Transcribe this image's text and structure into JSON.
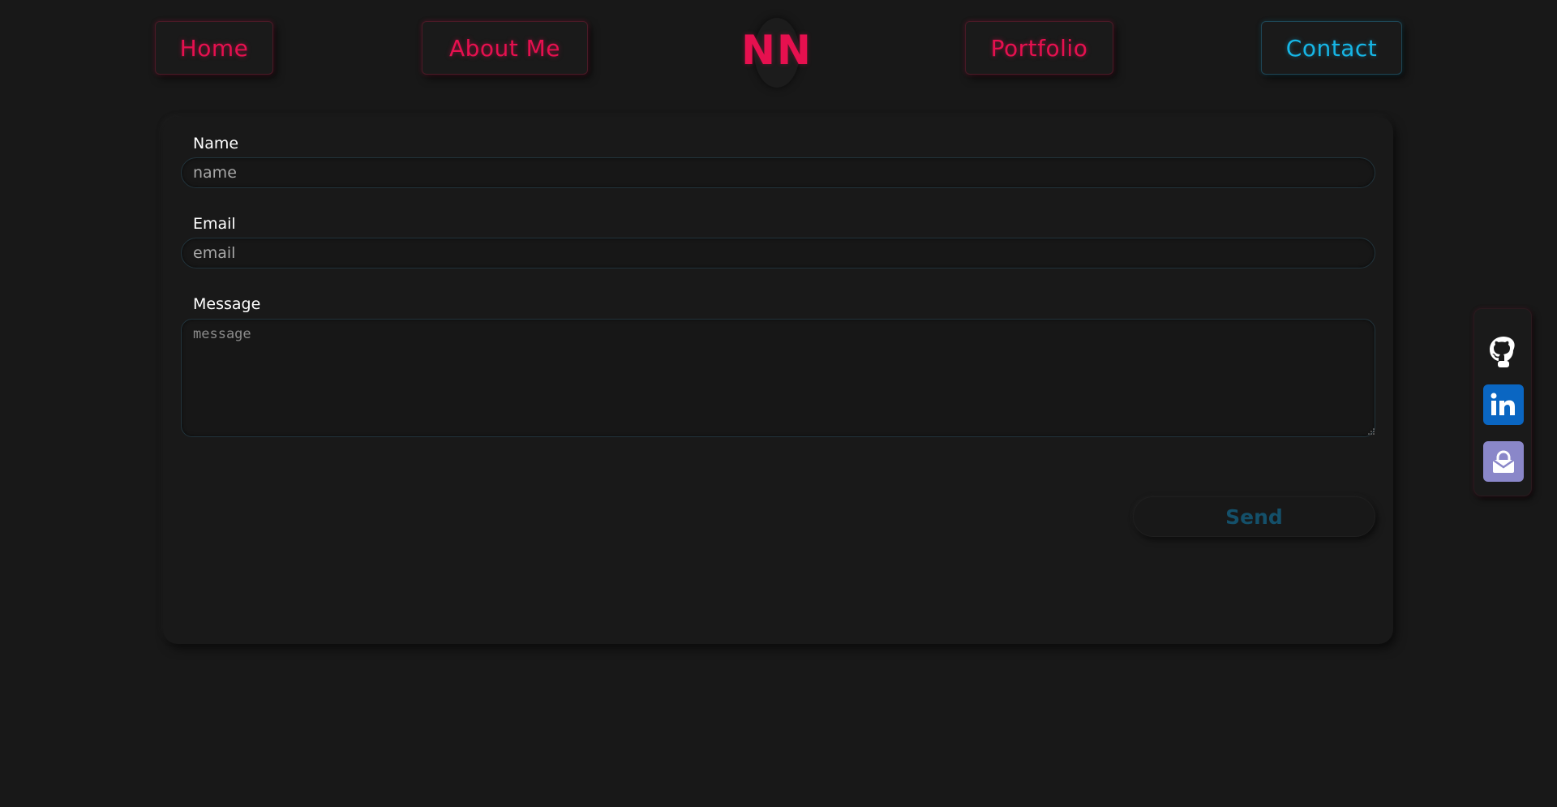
{
  "nav": {
    "home": "Home",
    "about": "About Me",
    "logo": "NN",
    "portfolio": "Portfolio",
    "contact": "Contact"
  },
  "form": {
    "name_label": "Name",
    "name_placeholder": "name",
    "email_label": "Email",
    "email_placeholder": "email",
    "message_label": "Message",
    "message_placeholder": "message",
    "send_label": "Send"
  },
  "social": {
    "items": [
      "github-icon",
      "linkedin-icon",
      "protonmail-icon"
    ]
  },
  "colors": {
    "background": "#181818",
    "accent_red": "#e6104f",
    "accent_blue": "#16b6e6",
    "send_text": "#14506a"
  }
}
